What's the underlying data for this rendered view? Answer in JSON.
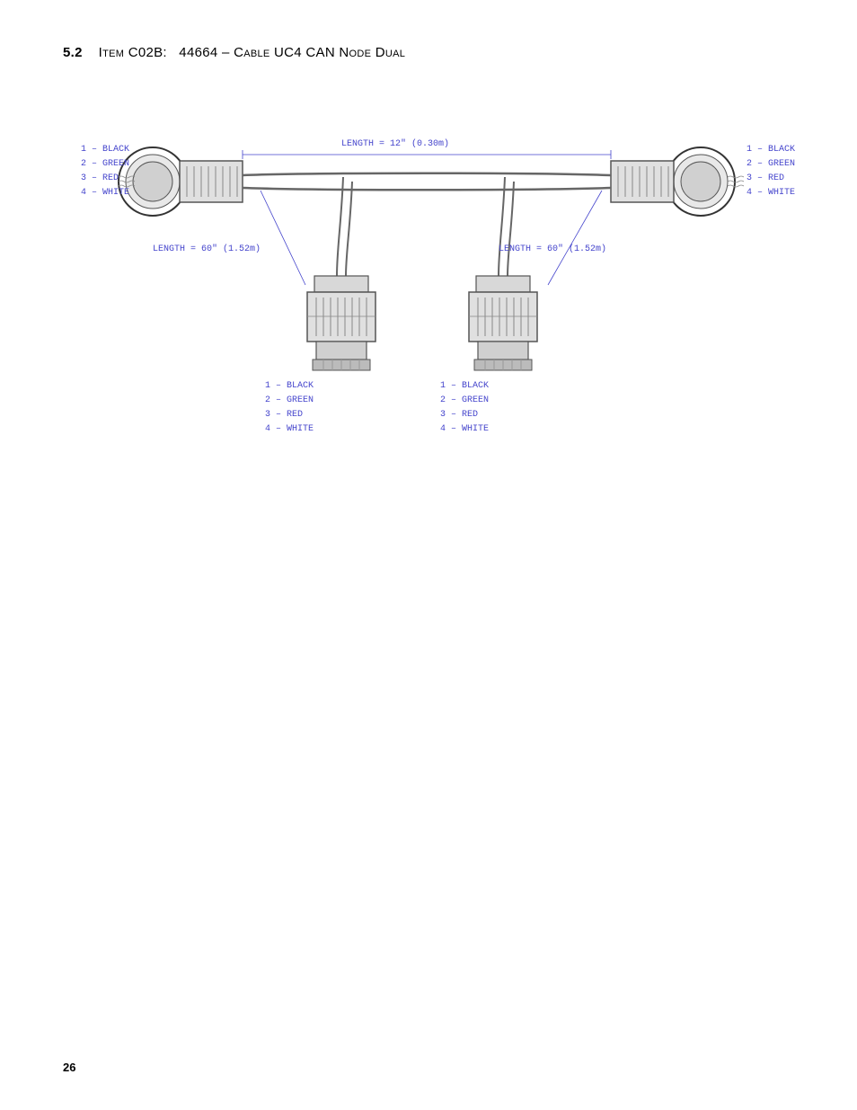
{
  "page": {
    "number": "26"
  },
  "section": {
    "number": "5.2",
    "title_prefix": "Item C02B:",
    "title_main": "44664 – Cable UC4 CAN Node Dual"
  },
  "diagram": {
    "length_top": "LENGTH = 12\" (0.30m)",
    "length_left": "LENGTH = 60\" (1.52m)",
    "length_right": "LENGTH = 60\" (1.52m)",
    "left_connector_labels": [
      "1 – BLACK",
      "2 – GREEN",
      "3 – RED",
      "4 – WHITE"
    ],
    "right_connector_labels": [
      "1 – BLACK",
      "2 – GREEN",
      "3 – RED",
      "4 – WHITE"
    ],
    "bottom_left_labels": [
      "1 – BLACK",
      "2 – GREEN",
      "3 – RED",
      "4 – WHITE"
    ],
    "bottom_right_labels": [
      "1 – BLACK",
      "2 – GREEN",
      "3 – RED",
      "4 – WHITE"
    ]
  }
}
